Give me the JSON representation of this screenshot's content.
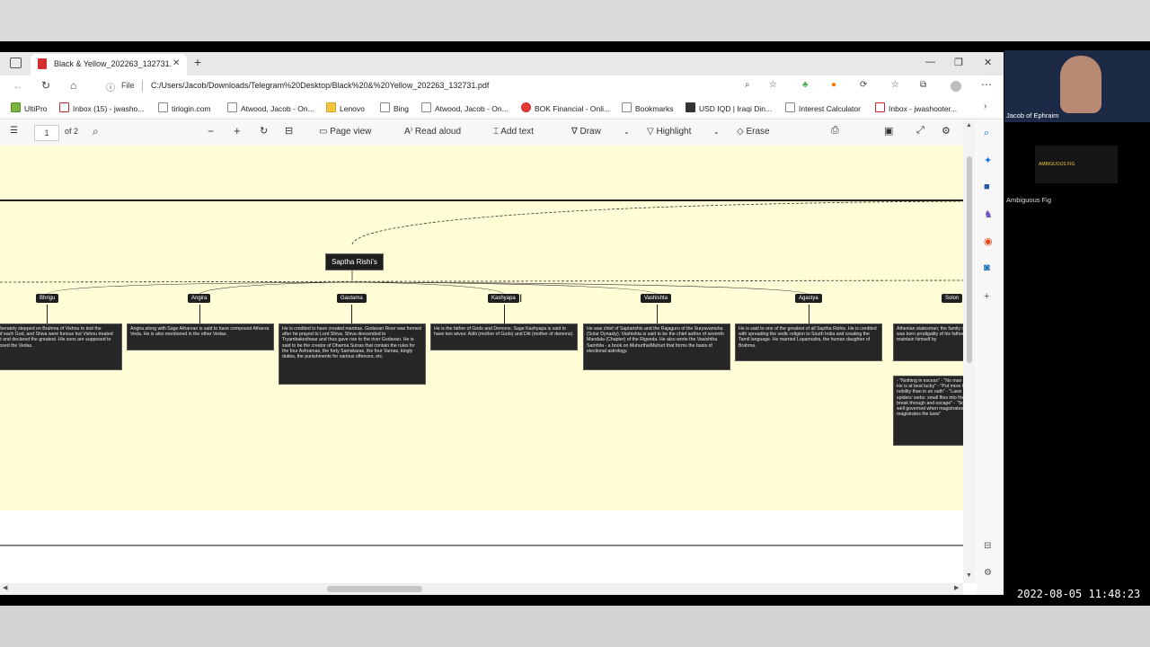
{
  "tab": {
    "title": "Black & Yellow_202263_132731.",
    "icon": "pdf-icon"
  },
  "address": {
    "prefix": "File",
    "url": "C:/Users/Jacob/Downloads/Telegram%20Desktop/Black%20&%20Yellow_202263_132731.pdf"
  },
  "favorites": [
    "UltiPro",
    "Inbox (15) - jwasho...",
    "tirlogin.com",
    "Atwood, Jacob - On...",
    "Lenovo",
    "Bing",
    "Atwood, Jacob - On...",
    "BOK Financial - Onli...",
    "Bookmarks",
    "USD IQD | Iraqi Din...",
    "Interest Calculator",
    "Inbox - jwashooter..."
  ],
  "pdf_toolbar": {
    "page": "1",
    "of_pages": "of 2",
    "page_view": "Page view",
    "read_aloud": "Read aloud",
    "add_text": "Add text",
    "draw": "Draw",
    "highlight": "Highlight",
    "erase": "Erase"
  },
  "tree": {
    "root": "Saptha Rishi's",
    "children": [
      {
        "name": "Bhrigu",
        "desc": "Bhrugu deliberately stepped on Brahma of Vishnu to test the greatness of each God, and Shiva were furious but Vishnu treated with respect and declared the greatest. His sons are supposed to have composed the Vedas."
      },
      {
        "name": "Angira",
        "desc": "Angira along with Sage Atharvan is said to have composed Atharva Veda. He is also mentioned in the other Vedas."
      },
      {
        "name": "Gautama",
        "desc": "He is credited to have created mantras. Godavari River was formed after he prayed to Lord Shiva. Shiva descended to Tryambakeshwar and thus gave rise to the river Godavari. He is said to be the creator of Dharma Sutras that contain the rules for the four Ashramas, the forty Samskaras, the four Varnas, kingly duties, the punishments for various offences, etc."
      },
      {
        "name": "Kashyapa",
        "desc": "He is the father of Gods and Demons. Sage Kashyapa is said to have two wives: Aditi (mother of Gods) and Diti (mother of demons)."
      },
      {
        "name": "Vashishta",
        "desc": "He was chief of Saptarishis and the Rajaguru of the Suryavamsha (Solar Dynasty). Vashishta is said to be the chief author of seventh Mandala (Chapter) of the Rigveda. He also wrote the Vasishtha Samhita - a book on Muhurtha/Muhurt that forms the basis of electional astrology."
      },
      {
        "name": "Agastya",
        "desc": "He is said to one of the greatest of all Saptha Rishis. He is credited with spreading the vedic religion to South India and creating the Tamil language. He married Lopamudra, the human daughter of Brahma."
      },
      {
        "name": "Solon",
        "desc": "Athenian statesman; the family of Codrus, was born prodigality of his father to maintain himself by"
      }
    ],
    "extra_desc": "- \"Nothing in excess\" - \"No man is happy. He is at best lucky\" - \"Put more trust in nobility than in an oath\" - \"Laws are like spiders' webs: small flies into them they break through and escape\" - \"Society is well governed when magistrates, and the magistrates the laws\""
  },
  "webcam": {
    "name_top": "Jacob of Ephraim",
    "name_bottom": "Ambiguous Fig",
    "thumb_label": "AMBIGUOUS FIG"
  },
  "timestamp": "2022-08-05  11:48:23"
}
